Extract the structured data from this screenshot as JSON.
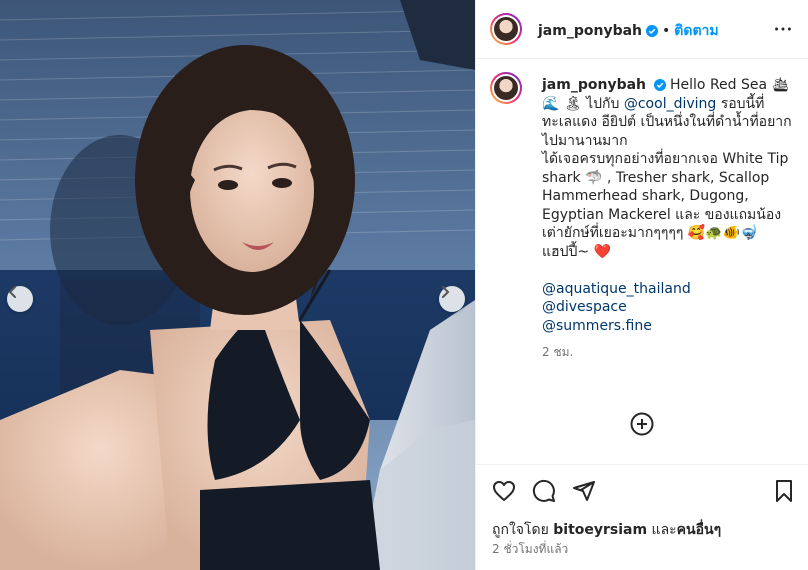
{
  "post": {
    "username": "jam_ponybah",
    "follow_label": "ติดตาม",
    "separator": "•"
  },
  "caption": {
    "username": "jam_ponybah",
    "line1": "Hello Red Sea 🛳",
    "line2": "🌊 🏝 ไปกับ ",
    "mention1": "@cool_diving",
    "line2b": " รอบนี้ที่",
    "body": "ทะเลแดง อียิปต์ เป็นหนึ่งในที่ดำน้ำที่อยากไปมานานมาก\nได้เจอครบทุกอย่างที่อยากเจอ White Tip shark 🦈 , Tresher shark, Scallop Hammerhead shark, Dugong, Egyptian Mackerel และ ของแถมน้องเต่ายักษ์ที่เยอะมากๆๆๆๆ 🥰🐢🐠🤿 แฮปปี้~ ❤️",
    "tags": [
      "@aquatique_thailand",
      "@divespace",
      "@summers.fine"
    ],
    "timestamp": "2 ชม."
  },
  "likes": {
    "prefix": "ถูกใจโดย ",
    "user": "bitoeyrsiam",
    "middle": " และ",
    "others": "คนอื่นๆ"
  },
  "time_ago": "2 ชั่วโมงที่แล้ว",
  "icons": {
    "verified": "verified-badge-icon",
    "more": "more-options-icon",
    "add_comment": "add-circle-icon",
    "like": "heart-icon",
    "comment": "comment-icon",
    "share": "send-icon",
    "save": "bookmark-icon",
    "prev": "chevron-left-icon",
    "next": "chevron-right-icon"
  },
  "colors": {
    "follow": "#0095f6",
    "mention": "#00376b",
    "verified": "#0095f6"
  }
}
